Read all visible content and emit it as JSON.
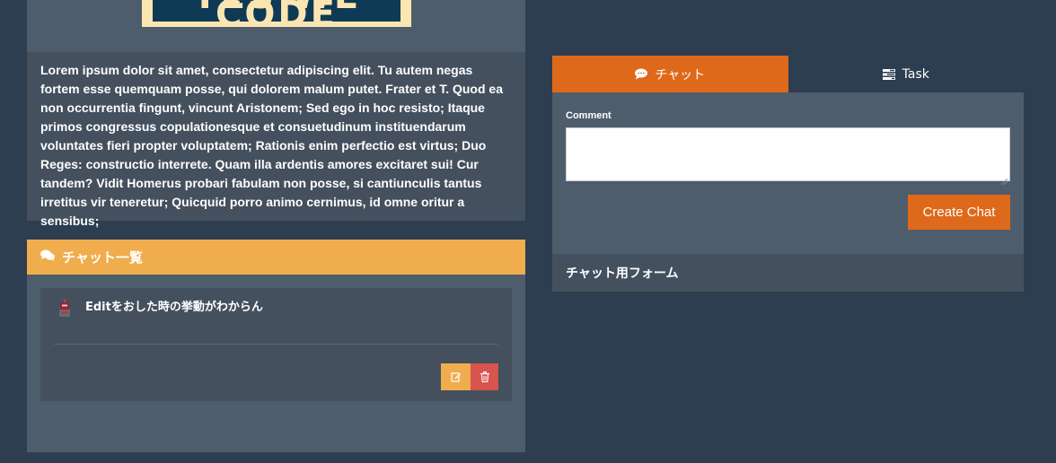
{
  "banner": {
    "text": "YES WE CODE"
  },
  "description": "Lorem ipsum dolor sit amet, consectetur adipiscing elit. Tu autem negas fortem esse quemquam posse, qui dolorem malum putet. Frater et T. Quod ea non occurrentia fingunt, vincunt Aristonem; Sed ego in hoc resisto; Itaque primos congressus copulationesque et consuetudinum instituendarum voluntates fieri propter voluptatem; Rationis enim perfectio est virtus; Duo Reges: constructio interrete. Quam illa ardentis amores excitaret sui! Cur tandem? Vidit Homerus probari fabulam non posse, si cantiunculis tantus irretitus vir teneretur; Quicquid porro animo cernimus, id omne oritur a sensibus;",
  "chat_list": {
    "title": "チャット一覧",
    "icon": "comments-icon",
    "items": [
      {
        "text": "Editをおした時の挙動がわからん",
        "avatar": "robot-avatar"
      }
    ]
  },
  "tabs": [
    {
      "label": "チャット",
      "icon": "comment-icon",
      "active": true
    },
    {
      "label": "Task",
      "icon": "tasks-icon",
      "active": false
    }
  ],
  "form": {
    "comment_label": "Comment",
    "comment_value": "",
    "submit_label": "Create Chat",
    "footer": "チャット用フォーム"
  },
  "colors": {
    "background": "#2c3e50",
    "panel": "#4e5d6c",
    "accent_orange": "#df691a",
    "warning": "#f0ad4e",
    "danger": "#d9534f"
  }
}
